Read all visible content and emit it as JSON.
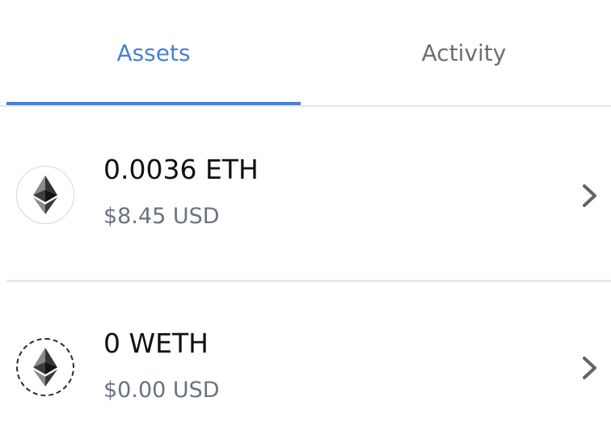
{
  "tabs": {
    "assets_label": "Assets",
    "activity_label": "Activity",
    "active": "Assets",
    "active_color": "#4a7fd3",
    "inactive_color": "#6b6f75"
  },
  "assets": [
    {
      "icon": "eth-icon",
      "balance": "0.0036 ETH",
      "fiat": "$8.45 USD"
    },
    {
      "icon": "weth-icon",
      "balance": "0 WETH",
      "fiat": "$0.00 USD"
    }
  ]
}
